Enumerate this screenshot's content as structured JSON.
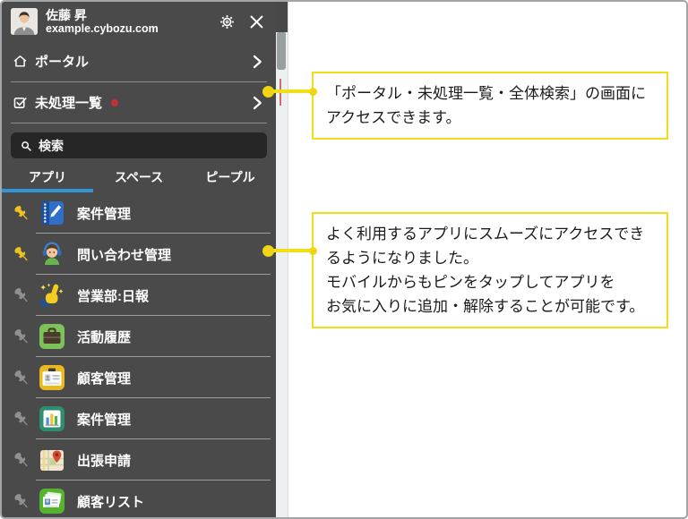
{
  "colors": {
    "sidebar_bg": "#4a4a4a",
    "accent_yellow": "#f2de17",
    "tab_active_blue": "#3195d6",
    "badge_red": "#c53030",
    "pin_pinned": "#eec31e",
    "pin_unpinned": "#919191"
  },
  "header": {
    "user_name": "佐藤 昇",
    "domain": "example.cybozu.com",
    "settings_icon": "gear-icon",
    "close_icon": "close-icon"
  },
  "nav": {
    "portal": {
      "label": "ポータル",
      "icon": "home-icon"
    },
    "pending": {
      "label": "未処理一覧",
      "icon": "checkbox-check-icon",
      "has_badge": true,
      "badge_color": "#c53030"
    }
  },
  "search": {
    "placeholder": "検索",
    "icon": "search-icon"
  },
  "tabs": {
    "active_index": 0,
    "items": [
      {
        "label": "アプリ"
      },
      {
        "label": "スペース"
      },
      {
        "label": "ピープル"
      }
    ]
  },
  "apps": [
    {
      "name": "案件管理",
      "icon": "notebook-icon",
      "pinned": true
    },
    {
      "name": "問い合わせ管理",
      "icon": "support-agent-icon",
      "pinned": true
    },
    {
      "name": "営業部:日報",
      "icon": "thumbs-up-icon",
      "pinned": false
    },
    {
      "name": "活動履歴",
      "icon": "briefcase-icon",
      "pinned": false
    },
    {
      "name": "顧客管理",
      "icon": "id-card-icon",
      "pinned": false
    },
    {
      "name": "案件管理",
      "icon": "bar-chart-icon",
      "pinned": false
    },
    {
      "name": "出張申請",
      "icon": "map-pin-icon",
      "pinned": false
    },
    {
      "name": "顧客リスト",
      "icon": "customer-cards-icon",
      "pinned": false
    }
  ],
  "callouts": [
    {
      "text": "「ポータル・未処理一覧・全体検索」の画面にアクセスできます。"
    },
    {
      "lines": [
        "よく利用するアプリにスムーズにアクセスできるようになりました。",
        "モバイルからもピンをタップしてアプリを",
        "お気に入りに追加・解除することが可能です。"
      ]
    }
  ]
}
